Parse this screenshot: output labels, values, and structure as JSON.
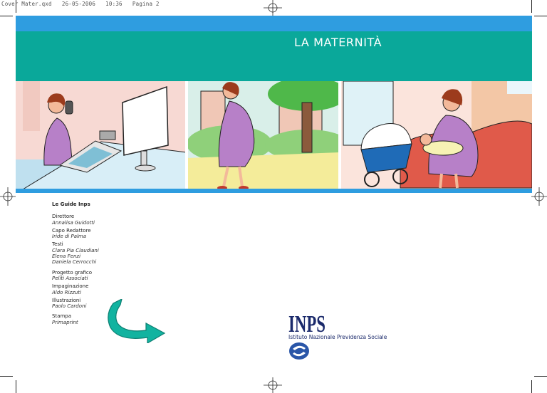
{
  "slug": "Cover Mater.qxd   26-05-2006   10:36   Pagina 2",
  "cover": {
    "title": "LA MATERNITÀ"
  },
  "credits": {
    "series": "Le Guide Inps",
    "groups": [
      {
        "role": "Direttore",
        "names": [
          "Annalisa Guidotti"
        ]
      },
      {
        "role": "Capo Redattore",
        "names": [
          "Iride di Palma"
        ]
      },
      {
        "role": "Testi",
        "names": [
          "Clara Pia Claudiani",
          "Elena Fenzi",
          "Daniela Cerrocchi"
        ]
      },
      {
        "role": "Progetto grafico",
        "names": [
          "Peliti Associati"
        ]
      },
      {
        "role": "Impaginazione",
        "names": [
          "Aldo Rizzuti"
        ]
      },
      {
        "role": "Illustrazioni",
        "names": [
          "Paolo Cardoni"
        ]
      },
      {
        "role": "Stampa",
        "names": [
          "Primaprint"
        ]
      }
    ]
  },
  "logo": {
    "wordmark": "INPS",
    "tagline": "Istituto Nazionale Previdenza Sociale"
  },
  "colors": {
    "blue": "#2f9de0",
    "teal": "#0aa89a",
    "inps_navy": "#1b2a6b"
  }
}
